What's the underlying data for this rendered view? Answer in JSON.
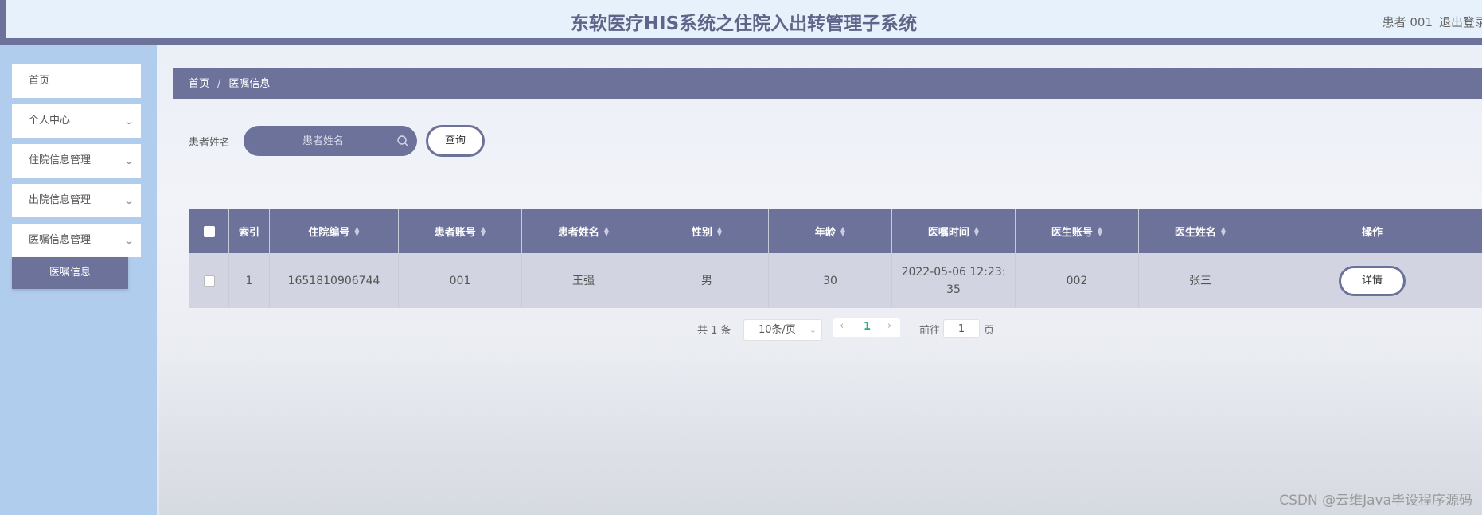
{
  "header": {
    "title": "东软医疗HIS系统之住院入出转管理子系统",
    "user": "患者 001",
    "logout": "退出登录"
  },
  "sidebar": {
    "items": [
      {
        "label": "首页",
        "chevron": false
      },
      {
        "label": "个人中心",
        "chevron": true
      },
      {
        "label": "住院信息管理",
        "chevron": true
      },
      {
        "label": "出院信息管理",
        "chevron": true
      },
      {
        "label": "医嘱信息管理",
        "chevron": true
      }
    ],
    "active_sub": "医嘱信息"
  },
  "breadcrumb": {
    "home": "首页",
    "separator": "/",
    "current": "医嘱信息"
  },
  "search": {
    "label": "患者姓名",
    "placeholder": "患者姓名",
    "value": "",
    "button": "查询"
  },
  "table": {
    "columns": [
      "索引",
      "住院编号",
      "患者账号",
      "患者姓名",
      "性别",
      "年龄",
      "医嘱时间",
      "医生账号",
      "医生姓名",
      "操作"
    ],
    "rows": [
      {
        "index": "1",
        "admission_no": "1651810906744",
        "patient_account": "001",
        "patient_name": "王强",
        "gender": "男",
        "age": "30",
        "order_time": "2022-05-06 12:23:35",
        "doctor_account": "002",
        "doctor_name": "张三",
        "action": "详情"
      }
    ]
  },
  "pagination": {
    "total": "共 1 条",
    "page_size": "10条/页",
    "current_page": "1",
    "goto_label": "前往",
    "goto_value": "1",
    "goto_unit": "页"
  },
  "watermark": "CSDN @云维Java毕设程序源码",
  "colors": {
    "accent": "#6c729a",
    "sidebar_bg": "#b1cdee",
    "header_bg": "#e6f1fb",
    "row_bg": "#d2d4e1",
    "page_active": "#2aa88a"
  }
}
